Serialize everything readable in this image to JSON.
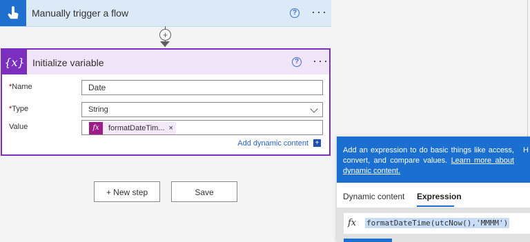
{
  "trigger": {
    "title": "Manually trigger a flow",
    "help_glyph": "?",
    "more_glyph": "···",
    "color": "#1f6fd1"
  },
  "connector": {
    "plus": "+"
  },
  "variable_card": {
    "icon_text": "{x}",
    "title": "Initialize variable",
    "help_glyph": "?",
    "more_glyph": "···",
    "accent": "#7b2fbe",
    "name_label": "Name",
    "name_value": "Date",
    "type_label": "Type",
    "type_value": "String",
    "value_label": "Value",
    "token_icon": "fx",
    "token_text": "formatDateTim...",
    "token_remove": "×",
    "add_dynamic": "Add dynamic content",
    "add_dynamic_glyph": "+",
    "required_marker": "*"
  },
  "buttons": {
    "new_step": "+ New step",
    "save": "Save"
  },
  "panel": {
    "info_text": "Add an expression to do basic things like access, convert, and compare values.",
    "info_link": "Learn more about dynamic content.",
    "info_hint": "H",
    "tabs": [
      "Dynamic content",
      "Expression"
    ],
    "active_tab": "Expression",
    "expr_icon": "fx",
    "expression": "formatDateTime(utcNow(),'MMMM')"
  }
}
